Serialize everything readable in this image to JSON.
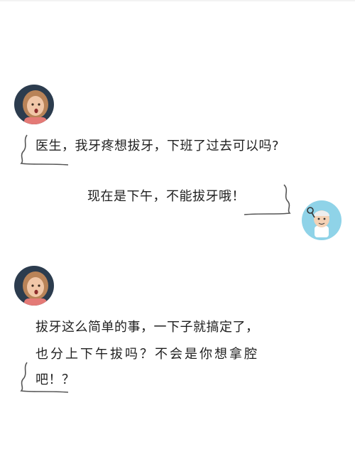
{
  "conversation": {
    "patient_message_1": "医生，我牙疼想拔牙，下班了过去可以吗?",
    "doctor_message": "现在是下午，不能拔牙哦！",
    "patient_message_2": {
      "line1": "拔牙这么简单的事，一下子就搞定了，",
      "line2": "也分上下午拔吗？不会是你想拿腔",
      "line3": "吧！？"
    }
  },
  "colors": {
    "doctor_avatar_bg": "#8fd3e8",
    "patient_avatar_bg": "#2c3c4e"
  },
  "icons": [
    "patient-avatar",
    "doctor-avatar",
    "bubble-corner-mark"
  ]
}
